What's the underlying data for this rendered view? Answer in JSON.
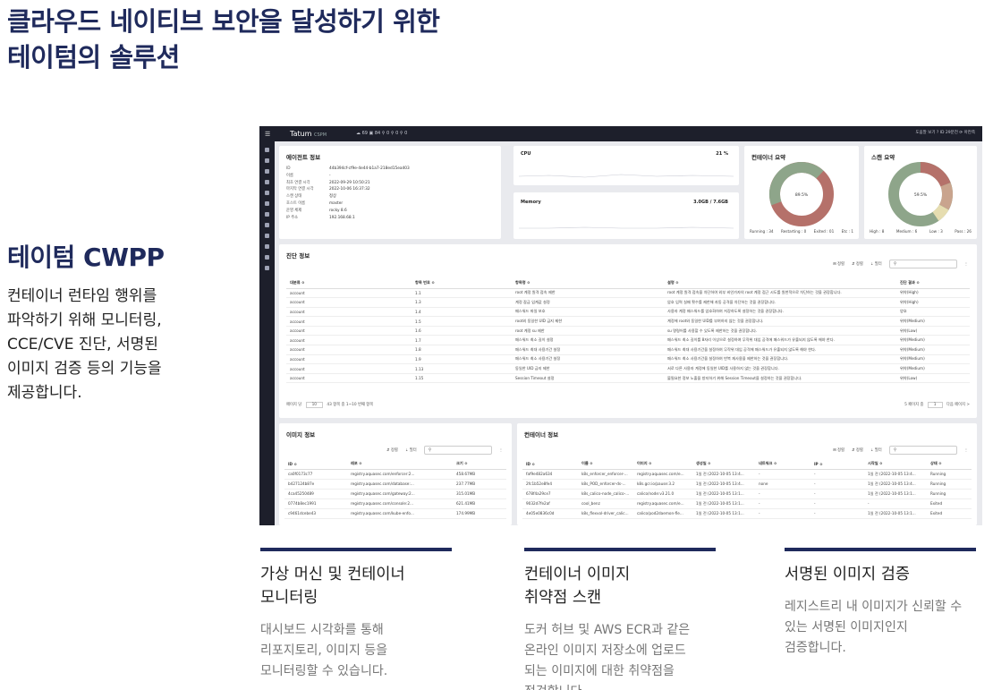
{
  "headline": [
    "클라우드 네이티브 보안을 달성하기 위한",
    "테이텀의 솔루션"
  ],
  "brand": "테이텀 CWPP",
  "brand_desc": [
    "컨테이너 런타임 행위를",
    "파악하기 위해 모니터링,",
    "CCE/CVE 진단, 서명된",
    "이미지 검증 등의 기능을",
    "제공합니다."
  ],
  "colors": {
    "navy": "#1f2a5c",
    "topbar": "#1d1f2b",
    "donut_green": "#8ea58a",
    "donut_red": "#b5716a",
    "donut_tan": "#c9a48e",
    "donut_cream": "#e6ddb0"
  },
  "dashboard": {
    "logo": "Tatum",
    "logo_sub": "CSPM",
    "topbar_stats": "☁ 69   ▣ 84   ⚲ 0   ⚲ 0   ⚲ 0",
    "topbar_right": "도움말 보기  ?   ID 29분전   ⟳   아칸쪽",
    "agent": {
      "title": "에이전트 정보",
      "rows": [
        {
          "k": "ID",
          "v": "44b394cf-cf9e-4e44-b1a7-218ed15ea403"
        },
        {
          "k": "이름",
          "v": "-"
        },
        {
          "k": "최초 연결 시각",
          "v": "2022-09-29 10:50:21"
        },
        {
          "k": "마지막 연결 시각",
          "v": "2022-10-06 16:37:32"
        },
        {
          "k": "스캔 상태",
          "v": "정상"
        },
        {
          "k": "호스트 이름",
          "v": "master"
        },
        {
          "k": "운영 체제",
          "v": "rocky 8.6"
        },
        {
          "k": "IP 주소",
          "v": "192.168.68.1"
        }
      ]
    },
    "cpu": {
      "label": "CPU",
      "value": "21 %",
      "fraction": 0.21
    },
    "memory": {
      "label": "Memory",
      "value": "3.0GB / 7.6GB",
      "fraction": 0.39
    },
    "container_summary": {
      "title": "컨테이너 요약",
      "center": "89.5%",
      "legend": [
        "Running : 34",
        "Restarting : 0",
        "Exited : 01",
        "Etc : 1"
      ]
    },
    "scan_summary": {
      "title": "스캔 요약",
      "center": "59.5%",
      "legend": [
        "High : 8",
        "Medium : 6",
        "Low : 3",
        "Pass : 26"
      ]
    },
    "diagnosis": {
      "title": "진단 정보",
      "tools": [
        "⊞ 정렬",
        "⇵ 정렬",
        "⇣ 필터"
      ],
      "search_icon": "⚲",
      "headers": [
        "대분류 ≎",
        "항목 번호 ≎",
        "항목명 ≎",
        "설명 ≎",
        "진단 결과 ≎"
      ],
      "rows": [
        [
          "account",
          "1.1",
          "root 계정 원격 접속 제한",
          "root 계정 원격 접속을 차단하여 외부 비인가자의 root 계정 접근 시도를 원천적으로 차단하는 것을 권장합니다.",
          "위약(High)"
        ],
        [
          "account",
          "1.3",
          "계정 잠금 임계값 설정",
          "암호 입력 실패 횟수를 제한해 자동 공격을 차단하는 것을 권장합니다.",
          "위약(High)"
        ],
        [
          "account",
          "1.4",
          "패스워드 파일 보호",
          "사용자 계정 패스워드를 암호화하여 저장하도록 설정하는 것을 권장합니다.",
          "양호"
        ],
        [
          "account",
          "1.5",
          "root외 동일한 UID 금지 제한",
          "계정에 root와 동일한 UID를 부여하지 않는 것을 권장합니다.",
          "위약(Medium)"
        ],
        [
          "account",
          "1.6",
          "root 계정 su 제한",
          "su 명령어를 사용할 수 있도록 제한하는 것을 권장합니다.",
          "위약(Low)"
        ],
        [
          "account",
          "1.7",
          "패스워드 최소 길이 설정",
          "패스워드 최소 길이를 8자리 이상으로 설정하여 무작위 대입 공격에 패스워드가 유출되지 않도록 해야 한다.",
          "위약(Medium)"
        ],
        [
          "account",
          "1.8",
          "패스워드 최대 사용기간 설정",
          "패스워드 최대 사용기간을 설정하여 무작위 대입 공격에 패스워드가 유출되지 않도록 해야 한다.",
          "위약(Medium)"
        ],
        [
          "account",
          "1.9",
          "패스워드 최소 사용기간 설정",
          "패스워드 최소 사용기간을 설정하여 반복 재사용을 제한하는 것을 권장합니다.",
          "위약(Medium)"
        ],
        [
          "account",
          "1.13",
          "동일한 UID 금지 제한",
          "서로 다른 사용자 계정에 동일한 UID를 사용하지 않는 것을 권장합니다.",
          "위약(Medium)"
        ],
        [
          "account",
          "1.15",
          "Session Timeout 설정",
          "불필요한 정보 노출을 방지하기 위해 Session Timeout을 설정하는 것을 권장합니다.",
          "위약(Low)"
        ]
      ],
      "pager_left": "페이지 당",
      "page_size": "10",
      "range": "43 항목 중 1~10 번째 항목",
      "pager_right": "5 페이지 중",
      "page": "1",
      "next": "다음 페이지 >"
    },
    "images": {
      "title": "이미지 정보",
      "tools": [
        "⇵ 정렬",
        "⇣ 필터"
      ],
      "search_icon": "⚲",
      "headers": [
        "ID ≎",
        "레포 ≎",
        "크기 ≎"
      ],
      "rows": [
        [
          "ca0f0173c77",
          "registry.aquasec.com/enforcer:2...",
          "458.67MB"
        ],
        [
          "b427124b87e",
          "registry.aquasec.com/database:...",
          "237.77MB"
        ],
        [
          "4ca45250489",
          "registry.aquasec.com/gateway:2...",
          "315.01MB"
        ],
        [
          "0774b8ec1991",
          "registry.aquasec.com/console:2...",
          "621.41MB"
        ],
        [
          "c9461dcebe43",
          "registry.aquasec.com/kube-enfo...",
          "174.99MB"
        ]
      ]
    },
    "containers": {
      "title": "컨테이너 정보",
      "tools": [
        "⊞ 정렬",
        "⇵ 정렬",
        "⇣ 필터"
      ],
      "search_icon": "⚲",
      "headers": [
        "ID ≎",
        "이름 ≎",
        "이미지 ≎",
        "생성일 ≎",
        "네트워크 ≎",
        "IP ≎",
        "시작일 ≎",
        "상태 ≎"
      ],
      "rows": [
        [
          "faf9e482a634",
          "k8s_enforcer_enforcer-...",
          "registry.aquasec.com/e...",
          "1일 전 (2022-10-05 13:4...",
          "-",
          "-",
          "1일 전 (2022-10-05 13:4...",
          "Running"
        ],
        [
          "2fc1b52e8fe4",
          "k8s_POD_enforcer-ds-...",
          "k8s.gcr.io/pause:3.2",
          "1일 전 (2022-10-05 13:4...",
          "none",
          "-",
          "1일 전 (2022-10-05 13:4...",
          "Running"
        ],
        [
          "678f4a29ce7",
          "k8s_calico-node_calico-...",
          "calico/node:v3.21.0",
          "1일 전 (2022-10-05 13:1...",
          "-",
          "-",
          "1일 전 (2022-10-05 13:1...",
          "Running"
        ],
        [
          "9032d7fe2af",
          "cool_benz",
          "registry.aquasec.com/e...",
          "1일 전 (2022-10-05 13:1...",
          "-",
          "-",
          "-",
          "Exited"
        ],
        [
          "4e05e0836c0d",
          "k8s_flexvol-driver_calic...",
          "calico/pod2daemon-fle...",
          "1일 전 (2022-10-05 13:1...",
          "-",
          "-",
          "1일 전 (2022-10-05 13:1...",
          "Exited"
        ]
      ]
    }
  },
  "features": [
    {
      "title": [
        "가상 머신 및 컨테이너",
        "모니터링"
      ],
      "desc": [
        "대시보드 시각화를 통해",
        "리포지토리, 이미지 등을",
        "모니터링할 수 있습니다."
      ]
    },
    {
      "title": [
        "컨테이너 이미지",
        "취약점 스캔"
      ],
      "desc": [
        "도커 허브 및 AWS ECR과 같은",
        "온라인 이미지 저장소에 업로드",
        "되는 이미지에 대한 취약점을",
        "점검합니다."
      ]
    },
    {
      "title": [
        "서명된 이미지 검증"
      ],
      "desc": [
        "레지스트리 내 이미지가 신뢰할 수",
        "있는 서명된 이미지인지",
        "검증합니다."
      ]
    }
  ]
}
